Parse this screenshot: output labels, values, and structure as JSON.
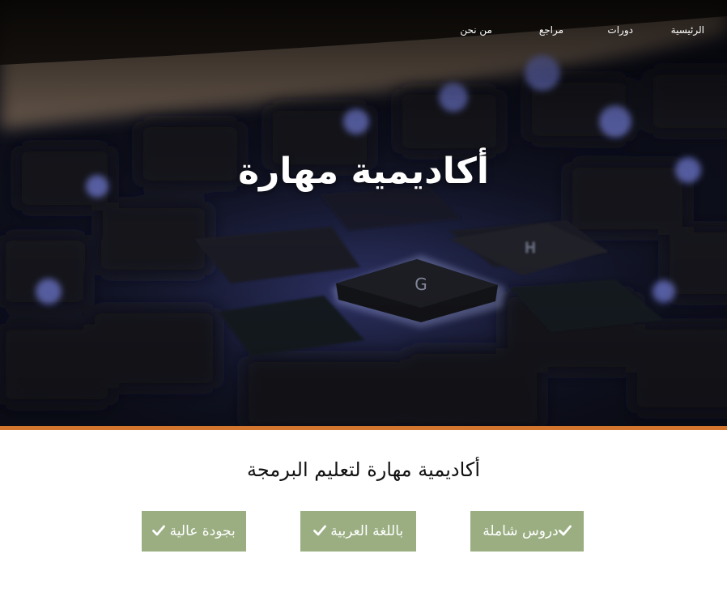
{
  "nav": {
    "items": [
      {
        "label": "الرئيسية"
      },
      {
        "label": "دورات"
      },
      {
        "label": "مراجع"
      },
      {
        "label": "من نحن"
      }
    ]
  },
  "hero": {
    "title": "أكاديمية مهارة"
  },
  "colors": {
    "accent": "#d4762e",
    "feature_bg": "#9aae82",
    "hero_bg": "#0b0d18"
  },
  "main": {
    "subtitle": "أكاديمية مهارة لتعليم البرمجة",
    "features": [
      {
        "label": "دروس شاملة",
        "icon": "check-icon"
      },
      {
        "label": "باللغة العربية",
        "icon": "check-icon"
      },
      {
        "label": "بجودة عالية",
        "icon": "check-icon"
      }
    ]
  }
}
